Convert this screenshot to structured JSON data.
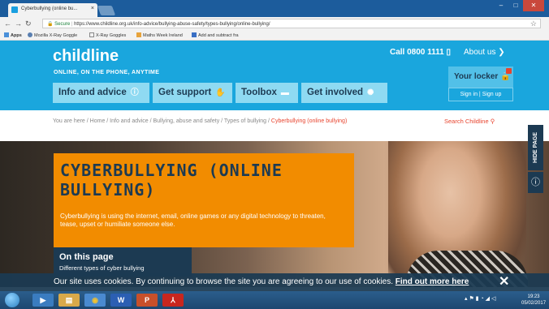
{
  "browser": {
    "tab_title": "Cyberbullying (online bu...",
    "tab_close": "×",
    "address_secure": "Secure",
    "address_url": "https://www.childline.org.uk/info-advice/bullying-abuse-safety/types-bullying/online-bullying/",
    "star": "☆",
    "bookmarks": [
      "Apps",
      "Mozilla X-Ray Goggle",
      "X-Ray Goggles",
      "Maths Week Ireland",
      "Add and subtract fra"
    ]
  },
  "site": {
    "logo": "childline",
    "tagline": "ONLINE, ON THE PHONE, ANYTIME",
    "call": "Call 0800 1111 ",
    "about": "About us ❯",
    "locker": "Your locker",
    "sign_in": "Sign in",
    "sign_up": "Sign up",
    "nav": [
      "Info and advice",
      "Get support",
      "Toolbox",
      "Get involved"
    ]
  },
  "breadcrumb": {
    "prefix": "You are here / Home / Info and advice / Bullying, abuse and safety / Types of bullying / ",
    "current": "Cyberbullying (online bullying)"
  },
  "search_label": "Search Childline",
  "page": {
    "title": "CYBERBULLYING (ONLINE BULLYING)",
    "intro": "Cyberbullying is using the internet, email, online games or any digital technology to threaten, tease, upset or humiliate someone else.",
    "on_this_page": "On this page",
    "otp_item": "Different types of cyber bullying"
  },
  "side_tabs": {
    "hide_page": "HIDE PAGE",
    "info": "ⓘ"
  },
  "cookie": {
    "message": "Our site uses cookies. By continuing to browse the site you are agreeing to our use of cookies. ",
    "link": "Find out more here",
    "close": "✕"
  },
  "taskbar": {
    "time": "19:23",
    "date": "05/02/2017"
  },
  "colors": {
    "brand_blue": "#1aa6dd",
    "navy": "#1c3a52",
    "orange": "#f28c00",
    "accent_red": "#e8442e"
  }
}
